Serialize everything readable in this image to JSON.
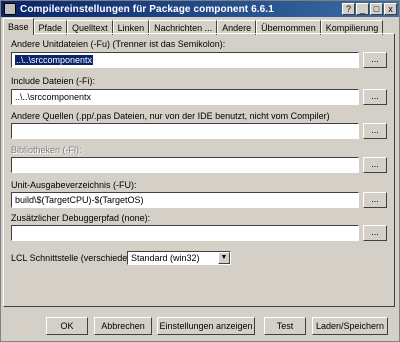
{
  "window": {
    "title": "Compilereinstellungen für Package component 6.6.1"
  },
  "titlebar_buttons": {
    "help": "?",
    "minimize": "_",
    "maximize": "□",
    "close": "x"
  },
  "tabs": [
    {
      "label": "Base"
    },
    {
      "label": "Pfade"
    },
    {
      "label": "Quelltext"
    },
    {
      "label": "Linken"
    },
    {
      "label": "Nachrichten ..."
    },
    {
      "label": "Andere"
    },
    {
      "label": "Übernommen"
    },
    {
      "label": "Kompilierung"
    }
  ],
  "fields": {
    "other_units": {
      "label": "Andere Unitdateien (-Fu) (Trenner ist das Semikolon):",
      "value": "..\\..\\srccomponentx",
      "browse": "..."
    },
    "include": {
      "label": "Include Dateien (-Fi):",
      "value": "..\\..\\srccomponentx",
      "browse": "..."
    },
    "other_sources": {
      "label": "Andere Quellen (.pp/.pas Dateien, nur von der IDE benutzt, nicht vom Compiler)",
      "value": "",
      "browse": "..."
    },
    "libraries": {
      "label": "Bibliotheken (-Fl):",
      "value": "",
      "browse": "..."
    },
    "unit_output": {
      "label": "Unit-Ausgabeverzeichnis (-FU):",
      "value": "build\\$(TargetCPU)-$(TargetOS)",
      "browse": "..."
    },
    "debug_path": {
      "label": "Zusätzlicher Debuggerpfad (none):",
      "value": "",
      "browse": "..."
    }
  },
  "lcl": {
    "label": "LCL Schnittstelle (verschiedene):",
    "selected": "Standard (win32)",
    "arrow": "▼"
  },
  "buttons": {
    "ok": "OK",
    "cancel": "Abbrechen",
    "show_options": "Einstellungen anzeigen",
    "test": "Test",
    "load_save": "Laden/Speichern"
  }
}
